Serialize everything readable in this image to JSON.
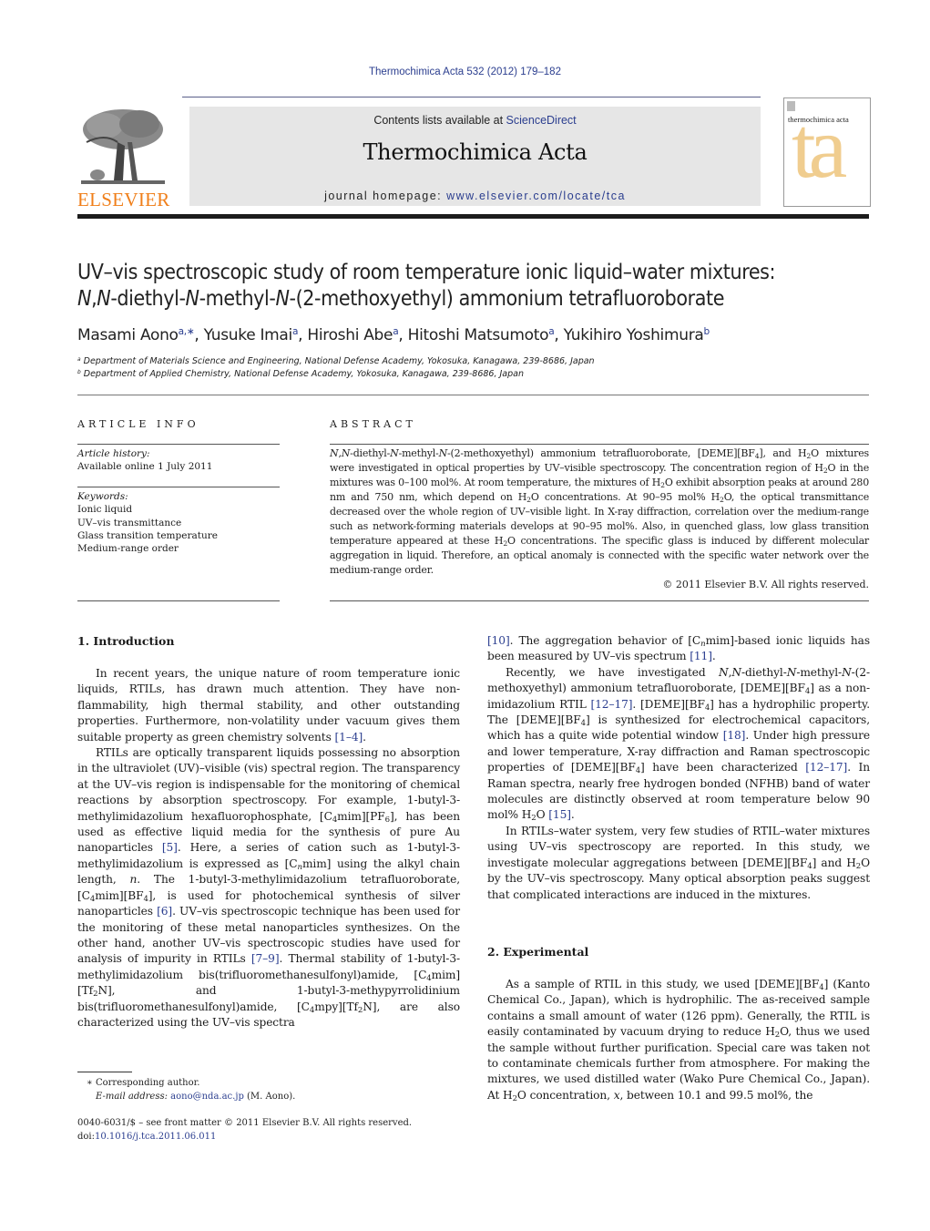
{
  "header": {
    "citation": "Thermochimica Acta 532 (2012) 179–182",
    "contents_prefix": "Contents lists available at ",
    "contents_link": "ScienceDirect",
    "journal_title": "Thermochimica Acta",
    "homepage_prefix": "journal homepage: ",
    "homepage_link": "www.elsevier.com/locate/tca",
    "publisher_logo_text": "ELSEVIER",
    "cover_title": "thermochimica acta",
    "cover_letters": "ta",
    "colors": {
      "link": "#2b3e8f",
      "elsevier_orange": "#f07f1a",
      "cover_tan": "#f0cd8f",
      "banner_gray": "#e6e6e6"
    }
  },
  "article": {
    "title_line1": "UV–vis spectroscopic study of room temperature ionic liquid–water mixtures:",
    "title_line2_parts": [
      "N",
      ",",
      "N",
      "-diethyl-",
      "N",
      "-methyl-",
      "N",
      "-(2-methoxyethyl) ammonium tetrafluoroborate"
    ],
    "authors": [
      {
        "name": "Masami Aono",
        "sup": "a,∗"
      },
      {
        "name": "Yusuke Imai",
        "sup": "a"
      },
      {
        "name": "Hiroshi Abe",
        "sup": "a"
      },
      {
        "name": "Hitoshi Matsumoto",
        "sup": "a"
      },
      {
        "name": "Yukihiro Yoshimura",
        "sup": "b"
      }
    ],
    "affiliations": [
      {
        "mark": "a",
        "text": "Department of Materials Science and Engineering, National Defense Academy, Yokosuka, Kanagawa, 239-8686, Japan"
      },
      {
        "mark": "b",
        "text": "Department of Applied Chemistry, National Defense Academy, Yokosuka, Kanagawa, 239-8686, Japan"
      }
    ]
  },
  "article_info": {
    "heading": "ARTICLE INFO",
    "history_label": "Article history:",
    "history_value": "Available online 1 July 2011",
    "keywords_label": "Keywords:",
    "keywords": [
      "Ionic liquid",
      "UV–vis transmittance",
      "Glass transition temperature",
      "Medium-range order"
    ]
  },
  "abstract": {
    "heading": "ABSTRACT",
    "text": "N,N-diethyl-N-methyl-N-(2-methoxyethyl) ammonium tetrafluoroborate, [DEME][BF4], and H2O mixtures were investigated in optical properties by UV–visible spectroscopy. The concentration region of H2O in the mixtures was 0–100 mol%. At room temperature, the mixtures of H2O exhibit absorption peaks at around 280 nm and 750 nm, which depend on H2O concentrations. At 90–95 mol% H2O, the optical transmittance decreased over the whole region of UV–visible light. In X-ray diffraction, correlation over the medium-range such as network-forming materials develops at 90–95 mol%. Also, in quenched glass, low glass transition temperature appeared at these H2O concentrations. The specific glass is induced by different molecular aggregation in liquid. Therefore, an optical anomaly is connected with the specific water network over the medium-range order.",
    "copyright": "© 2011 Elsevier B.V. All rights reserved."
  },
  "sections": {
    "intro_heading": "1.  Introduction",
    "exp_heading": "2.  Experimental"
  },
  "footnotes": {
    "corresponding": "∗ Corresponding author.",
    "email_label": "E-mail address: ",
    "email": "aono@nda.ac.jp",
    "email_suffix": " (M. Aono).",
    "frontmatter": "0040-6031/$ – see front matter © 2011 Elsevier B.V. All rights reserved.",
    "doi_prefix": "doi:",
    "doi": "10.1016/j.tca.2011.06.011"
  },
  "body_paragraphs": {
    "left": [
      [
        [
          "t",
          "In recent years, the unique nature of room temperature ionic liquids, RTILs, has drawn much attention. They have non-flammability, high thermal stability, and other outstanding properties. Furthermore, non-volatility under vacuum gives them suitable property as green chemistry solvents "
        ],
        [
          "ref",
          "[1–4]"
        ],
        [
          "t",
          "."
        ]
      ],
      [
        [
          "t",
          "RTILs are optically transparent liquids possessing no absorption in the ultraviolet (UV)–visible (vis) spectral region. The transparency at the UV–vis region is indispensable for the monitoring of chemical reactions by absorption spectroscopy. For example, 1-butyl-3-methylimidazolium hexafluorophosphate, [C"
        ],
        [
          "sub",
          "4"
        ],
        [
          "t",
          "mim][PF"
        ],
        [
          "sub",
          "6"
        ],
        [
          "t",
          "], has been used as effective liquid media for the synthesis of pure Au nanoparticles "
        ],
        [
          "ref",
          "[5]"
        ],
        [
          "t",
          ". Here, a series of cation such as 1-butyl-3-methylimidazolium is expressed as [C"
        ],
        [
          "subi",
          "n"
        ],
        [
          "t",
          "mim] using the alkyl chain length, "
        ],
        [
          "i",
          "n"
        ],
        [
          "t",
          ". The 1-butyl-3-methylimidazolium tetrafluoroborate, [C"
        ],
        [
          "sub",
          "4"
        ],
        [
          "t",
          "mim][BF"
        ],
        [
          "sub",
          "4"
        ],
        [
          "t",
          "], is used for photochemical synthesis of silver nanoparticles "
        ],
        [
          "ref",
          "[6]"
        ],
        [
          "t",
          ". UV–vis spectroscopic technique has been used for the monitoring of these metal nanoparticles synthesizes. On the other hand, another UV–vis spectroscopic studies have used for analysis of impurity in RTILs "
        ],
        [
          "ref",
          "[7–9]"
        ],
        [
          "t",
          ". Thermal stability of 1-butyl-3-methylimidazolium bis(trifluoromethanesulfonyl)amide, [C"
        ],
        [
          "sub",
          "4"
        ],
        [
          "t",
          "mim][Tf"
        ],
        [
          "sub",
          "2"
        ],
        [
          "t",
          "N], and 1-butyl-3-methypyrrolidinium bis(trifluoromethanesulfonyl)amide, [C"
        ],
        [
          "sub",
          "4"
        ],
        [
          "t",
          "mpy][Tf"
        ],
        [
          "sub",
          "2"
        ],
        [
          "t",
          "N], are also characterized using the UV–vis spectra"
        ]
      ]
    ],
    "right": [
      [
        [
          "ref",
          "[10]"
        ],
        [
          "t",
          ". The aggregation behavior of [C"
        ],
        [
          "subi",
          "n"
        ],
        [
          "t",
          "mim]-based ionic liquids has been measured by UV–vis spectrum "
        ],
        [
          "ref",
          "[11]"
        ],
        [
          "t",
          "."
        ]
      ],
      [
        [
          "t",
          "Recently, we have investigated "
        ],
        [
          "i",
          "N"
        ],
        [
          "t",
          ","
        ],
        [
          "i",
          "N"
        ],
        [
          "t",
          "-diethyl-"
        ],
        [
          "i",
          "N"
        ],
        [
          "t",
          "-methyl-"
        ],
        [
          "i",
          "N"
        ],
        [
          "t",
          "-(2-methoxyethyl) ammonium tetrafluoroborate, [DEME][BF"
        ],
        [
          "sub",
          "4"
        ],
        [
          "t",
          "] as a non-imidazolium RTIL "
        ],
        [
          "ref",
          "[12–17]"
        ],
        [
          "t",
          ". [DEME][BF"
        ],
        [
          "sub",
          "4"
        ],
        [
          "t",
          "] has a hydrophilic property. The [DEME][BF"
        ],
        [
          "sub",
          "4"
        ],
        [
          "t",
          "] is synthesized for electrochemical capacitors, which has a quite wide potential window "
        ],
        [
          "ref",
          "[18]"
        ],
        [
          "t",
          ". Under high pressure and lower temperature, X-ray diffraction and Raman spectroscopic properties of [DEME][BF"
        ],
        [
          "sub",
          "4"
        ],
        [
          "t",
          "] have been characterized "
        ],
        [
          "ref",
          "[12–17]"
        ],
        [
          "t",
          ". In Raman spectra, nearly free hydrogen bonded (NFHB) band of water molecules are distinctly observed at room temperature below 90 mol% H"
        ],
        [
          "sub",
          "2"
        ],
        [
          "t",
          "O "
        ],
        [
          "ref",
          "[15]"
        ],
        [
          "t",
          "."
        ]
      ],
      [
        [
          "t",
          "In RTILs–water system, very few studies of RTIL–water mixtures using UV–vis spectroscopy are reported. In this study, we investigate molecular aggregations between [DEME][BF"
        ],
        [
          "sub",
          "4"
        ],
        [
          "t",
          "] and H"
        ],
        [
          "sub",
          "2"
        ],
        [
          "t",
          "O by the UV–vis spectroscopy. Many optical absorption peaks suggest that complicated interactions are induced in the mixtures."
        ]
      ]
    ],
    "right2": [
      [
        [
          "t",
          "As a sample of RTIL in this study, we used [DEME][BF"
        ],
        [
          "sub",
          "4"
        ],
        [
          "t",
          "] (Kanto Chemical Co., Japan), which is hydrophilic. The as-received sample contains a small amount of water (126 ppm). Generally, the RTIL is easily contaminated by vacuum drying to reduce H"
        ],
        [
          "sub",
          "2"
        ],
        [
          "t",
          "O, thus we used the sample without further purification. Special care was taken not to contaminate chemicals further from atmosphere. For making the mixtures, we used distilled water (Wako Pure Chemical Co., Japan). At H"
        ],
        [
          "sub",
          "2"
        ],
        [
          "t",
          "O concentration, "
        ],
        [
          "i",
          "x"
        ],
        [
          "t",
          ", between 10.1 and 99.5 mol%, the"
        ]
      ]
    ]
  }
}
